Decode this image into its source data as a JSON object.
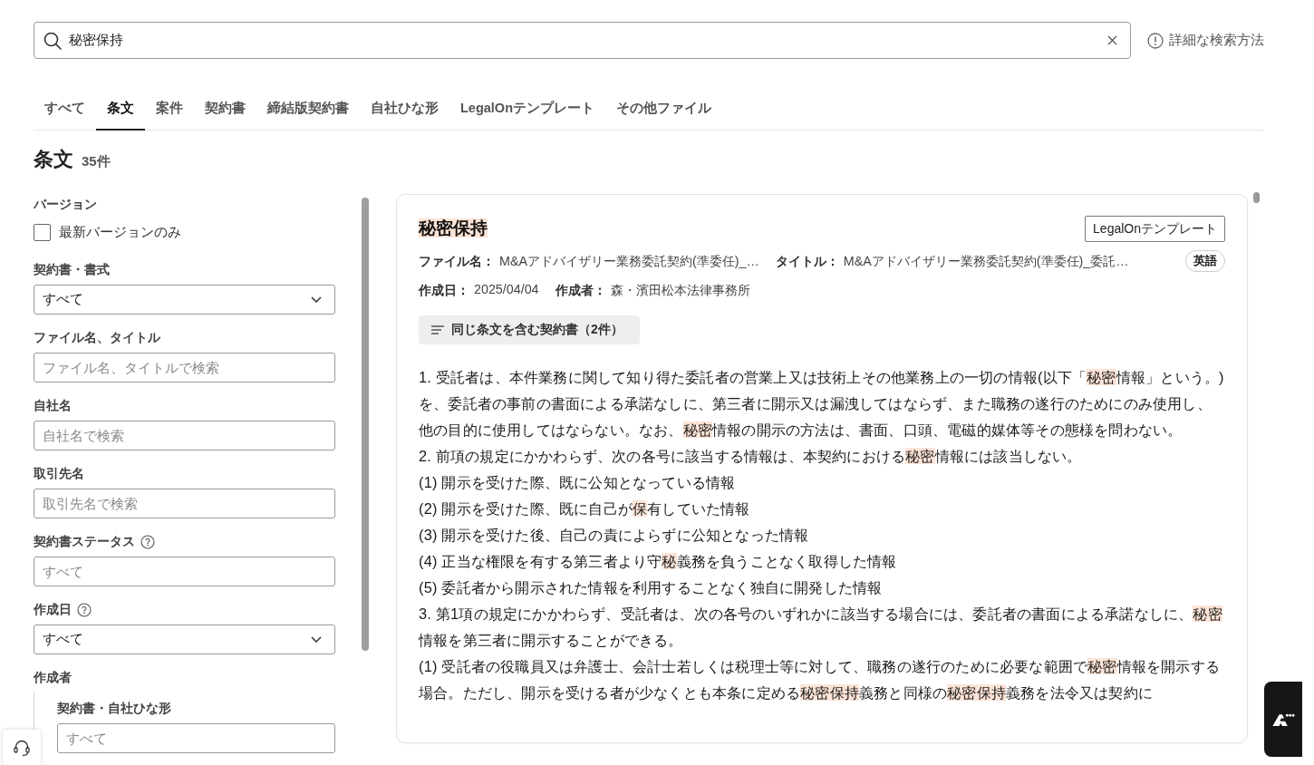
{
  "search": {
    "value": "秘密保持",
    "help_link": "詳細な検索方法"
  },
  "tabs": [
    {
      "label": "すべて",
      "selected": false
    },
    {
      "label": "条文",
      "selected": true
    },
    {
      "label": "案件",
      "selected": false
    },
    {
      "label": "契約書",
      "selected": false
    },
    {
      "label": "締結版契約書",
      "selected": false
    },
    {
      "label": "自社ひな形",
      "selected": false
    },
    {
      "label": "LegalOnテンプレート",
      "selected": false
    },
    {
      "label": "その他ファイル",
      "selected": false
    }
  ],
  "results": {
    "title": "条文",
    "count": "35件"
  },
  "filters": [
    {
      "kind": "checkbox",
      "label": "バージョン",
      "help": false,
      "option": "最新バージョンのみ",
      "checked": false
    },
    {
      "kind": "select",
      "label": "契約書・書式",
      "help": false,
      "value": "すべて"
    },
    {
      "kind": "input",
      "label": "ファイル名、タイトル",
      "help": false,
      "placeholder": "ファイル名、タイトルで検索"
    },
    {
      "kind": "input",
      "label": "自社名",
      "help": false,
      "placeholder": "自社名で検索"
    },
    {
      "kind": "input",
      "label": "取引先名",
      "help": false,
      "placeholder": "取引先名で検索"
    },
    {
      "kind": "input",
      "label": "契約書ステータス",
      "help": true,
      "placeholder": "すべて"
    },
    {
      "kind": "select",
      "label": "作成日",
      "help": true,
      "value": "すべて"
    },
    {
      "kind": "group",
      "label": "作成者",
      "help": false,
      "children": [
        {
          "kind": "input",
          "label": "契約書・自社ひな形",
          "help": false,
          "placeholder": "すべて"
        }
      ]
    }
  ],
  "result": {
    "title": [
      {
        "text": "秘密保持",
        "highlight": true
      }
    ],
    "source_tag": "LegalOnテンプレート",
    "meta_rows": [
      {
        "items": [
          {
            "label": "ファイル名：",
            "value": "M&Aアドバイザリー業務委託契約(準委任)_…"
          },
          {
            "label": "タイトル：",
            "value": "M&Aアドバイザリー業務委託契約(準委任)_委託…"
          }
        ],
        "tag": "英語"
      },
      {
        "items": [
          {
            "label": "作成日：",
            "value": "2025/04/04"
          },
          {
            "label": "作成者：",
            "value": "森・濱田松本法律事務所"
          }
        ]
      }
    ],
    "related_button": "同じ条文を含む契約書（2件）",
    "paragraphs": [
      {
        "segments": [
          {
            "text": "1. 受託者は、本件業務に関して知り得た委託者の営業上又は技術上その他業務上の一切の情報(以下「",
            "highlight": false
          },
          {
            "text": "秘密",
            "highlight": true
          },
          {
            "text": "情報」という。)を、委託者の事前の書面による承諾なしに、第三者に開示又は漏洩してはならず、また職務の遂行のためにのみ使用し、他の目的に使用してはならない。なお、",
            "highlight": false
          },
          {
            "text": "秘密",
            "highlight": true
          },
          {
            "text": "情報の開示の方法は、書面、口頭、電磁的媒体等その態様を問わない。",
            "highlight": false
          }
        ]
      },
      {
        "segments": [
          {
            "text": "2. 前項の規定にかかわらず、次の各号に該当する情報は、本契約における",
            "highlight": false
          },
          {
            "text": "秘密",
            "highlight": true
          },
          {
            "text": "情報には該当しない。",
            "highlight": false
          }
        ]
      },
      {
        "segments": [
          {
            "text": "(1) 開示を受けた際、既に公知となっている情報",
            "highlight": false
          }
        ]
      },
      {
        "segments": [
          {
            "text": "(2) 開示を受けた際、既に自己が",
            "highlight": false
          },
          {
            "text": "保",
            "highlight": true
          },
          {
            "text": "有していた情報",
            "highlight": false
          }
        ]
      },
      {
        "segments": [
          {
            "text": "(3) 開示を受けた後、自己の責によらずに公知となった情報",
            "highlight": false
          }
        ]
      },
      {
        "segments": [
          {
            "text": "(4) 正当な権限を有する第三者より守",
            "highlight": false
          },
          {
            "text": "秘",
            "highlight": true
          },
          {
            "text": "義務を負うことなく取得した情報",
            "highlight": false
          }
        ]
      },
      {
        "segments": [
          {
            "text": "(5) 委託者から開示された情報を利用することなく独自に開発した情報",
            "highlight": false
          }
        ]
      },
      {
        "segments": [
          {
            "text": "3. 第1項の規定にかかわらず、受託者は、次の各号のいずれかに該当する場合には、委託者の書面による承諾なしに、",
            "highlight": false
          },
          {
            "text": "秘密",
            "highlight": true
          },
          {
            "text": "情報を第三者に開示することができる。",
            "highlight": false
          }
        ]
      },
      {
        "segments": [
          {
            "text": "(1) 受託者の役職員又は弁護士、会計士若しくは税理士等に対して、職務の遂行のために必要な範囲で",
            "highlight": false
          },
          {
            "text": "秘密",
            "highlight": true
          },
          {
            "text": "情報を開示する場合。ただし、開示を受ける者が少なくとも本条に定める",
            "highlight": false
          },
          {
            "text": "秘密保持",
            "highlight": true
          },
          {
            "text": "義務と同様の",
            "highlight": false
          },
          {
            "text": "秘密保持",
            "highlight": true
          },
          {
            "text": "義務を法令又は契約に",
            "highlight": false
          }
        ]
      }
    ]
  }
}
